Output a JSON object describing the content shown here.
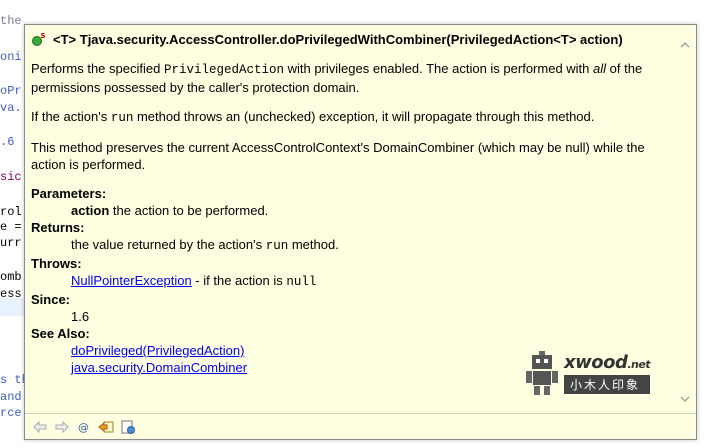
{
  "editor_background": {
    "lines": [
      {
        "text": "the",
        "color": "#7f7f9f"
      },
      {
        "text": "oni",
        "color": "#3f5fbf"
      },
      {
        "text": "oPr",
        "color": "#3f5fbf"
      },
      {
        "text": "va.",
        "color": "#3f5fbf"
      },
      {
        "text": ".6",
        "color": "#3f5fbf"
      },
      {
        "text": "sic",
        "color": "#7f0055"
      },
      {
        "text": "rol",
        "color": "#000000"
      },
      {
        "text": "e =",
        "color": "#000000"
      },
      {
        "text": "urr",
        "color": "#000000"
      },
      {
        "text": "omb",
        "color": "#000000"
      },
      {
        "text": "ess",
        "color": "#000000"
      },
      {
        "text": "s th",
        "color": "#3f5fbf"
      },
      {
        "text": "and",
        "color": "#3f5fbf"
      },
      {
        "text": "rce",
        "color": "#3f5fbf"
      }
    ]
  },
  "javadoc": {
    "signature_prefix": "<T> T ",
    "signature_method": "java.security.AccessController.doPrivilegedWithCombiner",
    "signature_params": "(PrivilegedAction<T> action)",
    "para1_a": "Performs the specified ",
    "para1_code": "PrivilegedAction",
    "para1_b": " with privileges enabled. The action is performed with ",
    "para1_em": "all",
    "para1_c": " of the permissions possessed by the caller's protection domain.",
    "para2_a": "If the action's ",
    "para2_code": "run",
    "para2_b": " method throws an (unchecked) exception, it will propagate through this method.",
    "para3": "This method preserves the current AccessControlContext's DomainCombiner (which may be null) while the action is performed.",
    "parameters_label": "Parameters:",
    "param_name": "action",
    "param_desc": " the action to be performed.",
    "returns_label": "Returns:",
    "returns_a": "the value returned by the action's ",
    "returns_code": "run",
    "returns_b": " method.",
    "throws_label": "Throws:",
    "throws_link": "NullPointerException",
    "throws_a": " - if the action is ",
    "throws_code": "null",
    "since_label": "Since:",
    "since_value": "1.6",
    "see_also_label": "See Also:",
    "see_also_links": [
      "doPrivileged(PrivilegedAction)",
      "java.security.DomainCombiner"
    ]
  },
  "toolbar": {
    "icons": [
      "back-icon",
      "forward-icon",
      "at-icon",
      "open-declaration-icon",
      "open-attached-javadoc-icon"
    ]
  },
  "watermark": {
    "brand": "xwood",
    "brand_suffix": ".net",
    "chinese": "小木人印象"
  }
}
